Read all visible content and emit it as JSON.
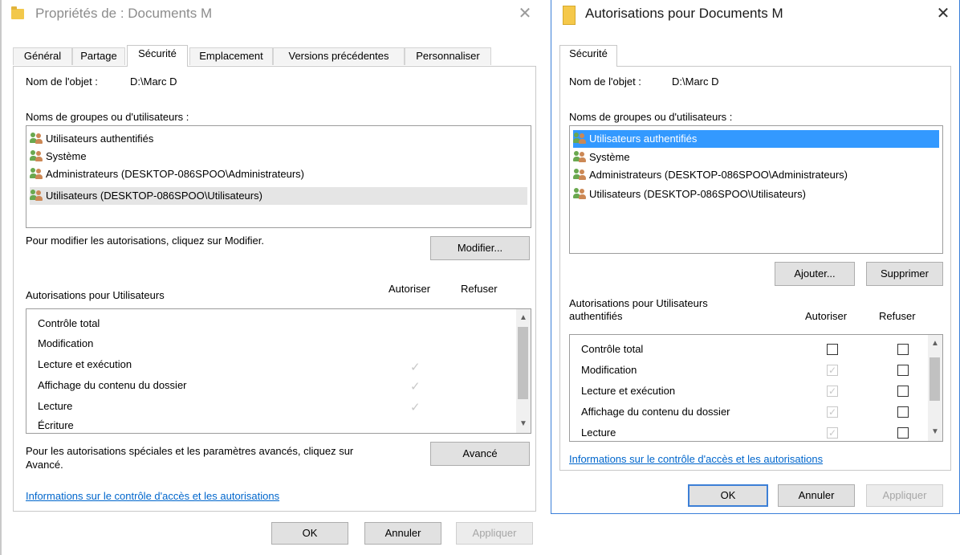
{
  "dialog1": {
    "title": "Propriétés de : Documents M",
    "close": "✕",
    "tabs": [
      "Général",
      "Partage",
      "Sécurité",
      "Emplacement",
      "Versions précédentes",
      "Personnaliser"
    ],
    "active_tab": "Sécurité",
    "object_label": "Nom de l'objet :",
    "object_value": "D:\\Marc D",
    "groups_label": "Noms de groupes ou d'utilisateurs :",
    "groups": [
      "Utilisateurs authentifiés",
      "Système",
      "Administrateurs (DESKTOP-086SPOO\\Administrateurs)",
      "Utilisateurs (DESKTOP-086SPOO\\Utilisateurs)"
    ],
    "modify_hint": "Pour modifier les autorisations, cliquez sur Modifier.",
    "modify_button": "Modifier...",
    "perm_title": "Autorisations pour Utilisateurs",
    "col_allow": "Autoriser",
    "col_deny": "Refuser",
    "permissions": [
      {
        "name": "Contrôle total",
        "allow": false
      },
      {
        "name": "Modification",
        "allow": false
      },
      {
        "name": "Lecture et exécution",
        "allow": true
      },
      {
        "name": "Affichage du contenu du dossier",
        "allow": true
      },
      {
        "name": "Lecture",
        "allow": true
      },
      {
        "name": "Écriture",
        "allow": false
      }
    ],
    "advanced_hint_1": "Pour les autorisations spéciales et les paramètres avancés, cliquez sur",
    "advanced_hint_2": "Avancé.",
    "advanced_button": "Avancé",
    "info_link": "Informations sur le contrôle d'accès et les autorisations",
    "ok": "OK",
    "cancel": "Annuler",
    "apply": "Appliquer"
  },
  "dialog2": {
    "title": "Autorisations pour Documents M",
    "close": "✕",
    "tab": "Sécurité",
    "object_label": "Nom de l'objet :",
    "object_value": "D:\\Marc D",
    "groups_label": "Noms de groupes ou d'utilisateurs :",
    "groups": [
      "Utilisateurs authentifiés",
      "Système",
      "Administrateurs (DESKTOP-086SPOO\\Administrateurs)",
      "Utilisateurs (DESKTOP-086SPOO\\Utilisateurs)"
    ],
    "add_button": "Ajouter...",
    "remove_button": "Supprimer",
    "perm_title_1": "Autorisations pour Utilisateurs",
    "perm_title_2": "authentifiés",
    "col_allow": "Autoriser",
    "col_deny": "Refuser",
    "permissions": [
      {
        "name": "Contrôle total",
        "allow": "empty",
        "deny": "empty"
      },
      {
        "name": "Modification",
        "allow": "greyed-checked",
        "deny": "empty"
      },
      {
        "name": "Lecture et exécution",
        "allow": "greyed-checked",
        "deny": "empty"
      },
      {
        "name": "Affichage du contenu du dossier",
        "allow": "greyed-checked",
        "deny": "empty"
      },
      {
        "name": "Lecture",
        "allow": "greyed-checked",
        "deny": "empty"
      }
    ],
    "info_link": "Informations sur le contrôle d'accès et les autorisations",
    "ok": "OK",
    "cancel": "Annuler",
    "apply": "Appliquer"
  },
  "icons": {
    "check": "✓",
    "scroll_up": "▲",
    "scroll_down": "▼"
  },
  "colors": {
    "selection": "#3399ff",
    "link": "#0066cc",
    "default_button_border": "#3c7fd6"
  }
}
